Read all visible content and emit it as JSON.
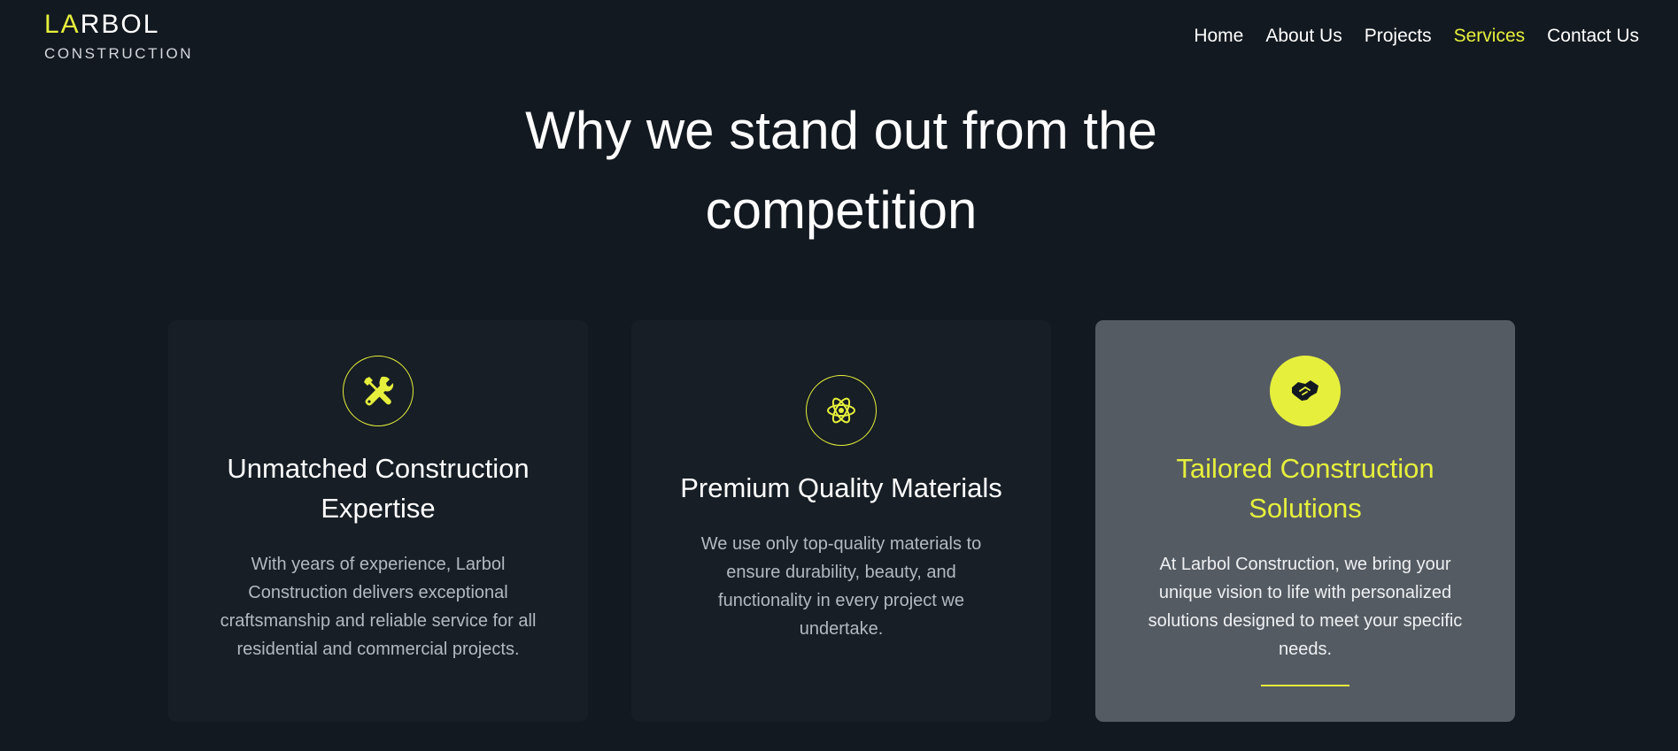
{
  "header": {
    "logo_prefix": "LA",
    "logo_rest": "RBOL",
    "logo_sub": "CONSTRUCTION",
    "nav": [
      {
        "label": "Home"
      },
      {
        "label": "About Us"
      },
      {
        "label": "Projects"
      },
      {
        "label": "Services",
        "active": true
      },
      {
        "label": "Contact Us"
      }
    ]
  },
  "section": {
    "heading": "Why we stand out from the competition"
  },
  "cards": [
    {
      "icon": "tools-icon",
      "title": "Unmatched Construction Expertise",
      "text": "With years of experience, Larbol Construction delivers exceptional craftsmanship and reliable service for all residential and commercial projects."
    },
    {
      "icon": "atom-icon",
      "title": "Premium Quality Materials",
      "text": "We use only top-quality materials to ensure durability, beauty, and functionality in every project we undertake."
    },
    {
      "icon": "handshake-icon",
      "title": "Tailored Construction Solutions",
      "text": "At Larbol Construction, we bring your unique vision to life with personalized solutions designed to meet your specific needs.",
      "highlighted": true
    }
  ],
  "colors": {
    "background": "#131920",
    "card": "#171e25",
    "card_highlight": "#555b63",
    "accent": "#e6f03c"
  }
}
